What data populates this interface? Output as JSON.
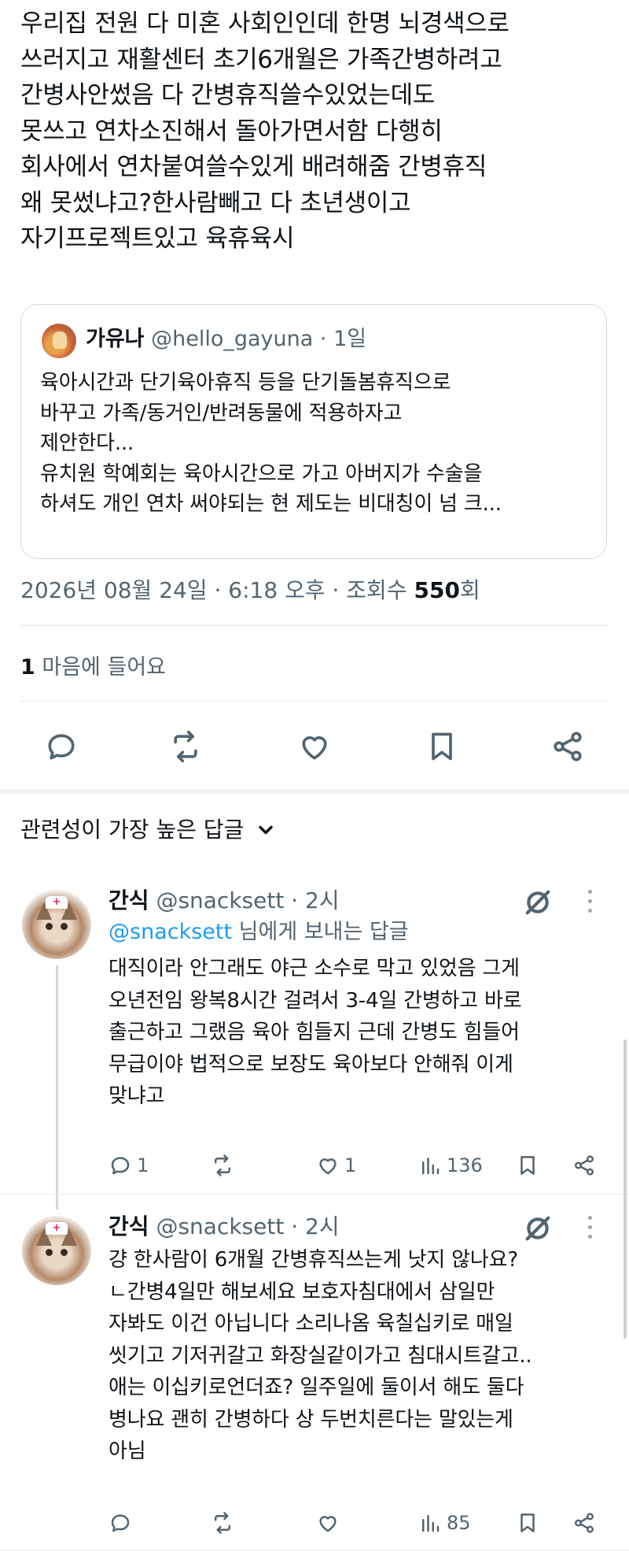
{
  "post": {
    "text": "우리집 전원 다 미혼 사회인인데 한명 뇌경색으로\n쓰러지고 재활센터 초기6개월은 가족간병하려고\n간병사안썼음 다 간병휴직쓸수있었는데도\n못쓰고 연차소진해서 돌아가면서함 다행히\n회사에서 연차붙여쓸수있게 배려해줌 간병휴직\n왜 못썼냐고?한사람빼고 다 초년생이고\n자기프로젝트있고 육휴육시",
    "quote": {
      "name": "가유나",
      "handle": "@hello_gayuna",
      "time": "· 1일",
      "text": "육아시간과 단기육아휴직 등을 단기돌봄휴직으로\n바꾸고 가족/동거인/반려동물에 적용하자고\n제안한다...\n유치원 학예회는 육아시간으로 가고 아버지가 수술을\n하셔도 개인 연차 써야되는 현 제도는 비대칭이 넘 크..."
    },
    "timestamp": "2026년 08월 24일 · 6:18 오후 · 조회수 ",
    "views": "550",
    "views_suffix": "회",
    "likes_count": "1",
    "likes_label": " 마음에 들어요"
  },
  "actions": {
    "reply_icon": "reply-icon",
    "retweet_icon": "retweet-icon",
    "like_icon": "heart-icon",
    "bookmark_icon": "bookmark-icon",
    "share_icon": "share-icon"
  },
  "sort": {
    "label": "관련성이 가장 높은 답글"
  },
  "replies": [
    {
      "name": "간식",
      "handle": "@snacksett",
      "time": "· 2시",
      "replying_handle": "@snacksett",
      "replying_suffix": " 님에게 보내는 답글",
      "text": "대직이라 안그래도 야근 소수로 막고 있었음 그게\n오년전임 왕복8시간 걸려서 3-4일 간병하고 바로\n출근하고 그랬음 육아 힘들지 근데 간병도 힘들어\n무급이야 법적으로 보장도 육아보다 안해줘 이게\n맞냐고",
      "reply_count": "1",
      "retweet_count": "",
      "like_count": "1",
      "view_count": "136"
    },
    {
      "name": "간식",
      "handle": "@snacksett",
      "time": "· 2시",
      "text": "걍 한사람이 6개월 간병휴직쓰는게 낫지 않나요?\nㄴ간병4일만 해보세요 보호자침대에서 삼일만\n자봐도 이건 아닙니다 소리나옴 육칠십키로 매일\n씻기고 기저귀갈고 화장실같이가고 침대시트갈고..\n애는 이십키로언더죠? 일주일에 둘이서 해도 둘다\n병나요 괜히 간병하다 상 두번치른다는 말있는게\n아님",
      "reply_count": "",
      "retweet_count": "",
      "like_count": "",
      "view_count": "85"
    }
  ]
}
